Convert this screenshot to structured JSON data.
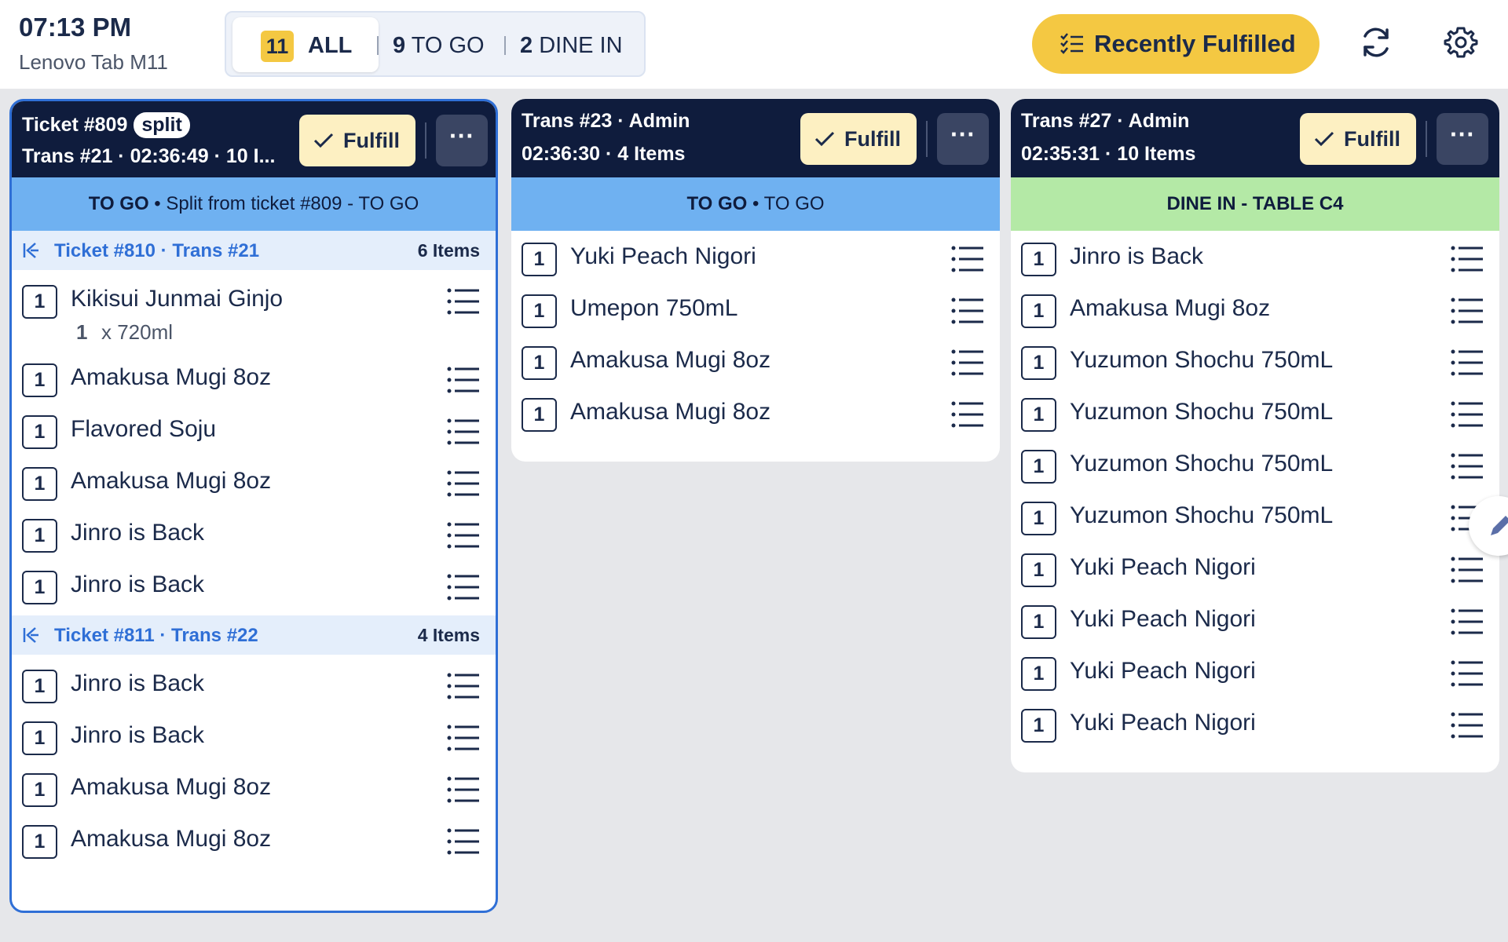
{
  "header": {
    "time": "07:13 PM",
    "device": "Lenovo Tab M11",
    "filters": {
      "all_count": "11",
      "all_label": "ALL",
      "togo_count": "9",
      "togo_label": "TO GO",
      "dine_count": "2",
      "dine_label": "DINE IN"
    },
    "recent_label": "Recently Fulfilled",
    "accent_color": "#f4c842"
  },
  "cards": [
    {
      "title": "Ticket #809",
      "badge": "split",
      "line2": "Trans #21 · 02:36:49 · 10 I...",
      "fulfill_label": "Fulfill",
      "more_label": "···",
      "banner_type": "TO GO",
      "banner_sep": "•",
      "banner_text": "Split from ticket #809 - TO GO",
      "groups": [
        {
          "label": "Ticket #810 · Trans #21",
          "count": "6 Items",
          "items": [
            {
              "qty": "1",
              "name": "Kikisui Junmai Ginjo",
              "mod_qty": "1",
              "mod_text": "x 720ml"
            },
            {
              "qty": "1",
              "name": "Amakusa Mugi 8oz"
            },
            {
              "qty": "1",
              "name": "Flavored Soju"
            },
            {
              "qty": "1",
              "name": "Amakusa Mugi 8oz"
            },
            {
              "qty": "1",
              "name": "Jinro is Back"
            },
            {
              "qty": "1",
              "name": "Jinro is Back"
            }
          ]
        },
        {
          "label": "Ticket #811 · Trans #22",
          "count": "4 Items",
          "items": [
            {
              "qty": "1",
              "name": "Jinro is Back"
            },
            {
              "qty": "1",
              "name": "Jinro is Back"
            },
            {
              "qty": "1",
              "name": "Amakusa Mugi 8oz"
            },
            {
              "qty": "1",
              "name": "Amakusa Mugi 8oz"
            }
          ]
        }
      ]
    },
    {
      "title": "Trans #23 · Admin",
      "line2": "02:36:30 · 4 Items",
      "fulfill_label": "Fulfill",
      "more_label": "···",
      "banner_type": "TO GO",
      "banner_sep": "•",
      "banner_text": "TO GO",
      "items": [
        {
          "qty": "1",
          "name": "Yuki Peach Nigori"
        },
        {
          "qty": "1",
          "name": "Umepon 750mL"
        },
        {
          "qty": "1",
          "name": "Amakusa Mugi 8oz"
        },
        {
          "qty": "1",
          "name": "Amakusa Mugi 8oz"
        }
      ]
    },
    {
      "title": "Trans #27 · Admin",
      "line2": "02:35:31 · 10 Items",
      "fulfill_label": "Fulfill",
      "more_label": "···",
      "banner_text": "DINE IN - TABLE C4",
      "items": [
        {
          "qty": "1",
          "name": "Jinro is Back"
        },
        {
          "qty": "1",
          "name": "Amakusa Mugi 8oz"
        },
        {
          "qty": "1",
          "name": "Yuzumon Shochu 750mL"
        },
        {
          "qty": "1",
          "name": "Yuzumon Shochu 750mL"
        },
        {
          "qty": "1",
          "name": "Yuzumon Shochu 750mL"
        },
        {
          "qty": "1",
          "name": "Yuzumon Shochu 750mL"
        },
        {
          "qty": "1",
          "name": "Yuki Peach Nigori"
        },
        {
          "qty": "1",
          "name": "Yuki Peach Nigori"
        },
        {
          "qty": "1",
          "name": "Yuki Peach Nigori"
        },
        {
          "qty": "1",
          "name": "Yuki Peach Nigori"
        }
      ]
    }
  ],
  "colors": {
    "header_dark": "#0f1c3d",
    "togo_banner": "#6fb1f1",
    "dine_banner": "#b4e9a6",
    "selected_border": "#2f6fd6",
    "fulfill_bg": "#fdf0c2"
  }
}
